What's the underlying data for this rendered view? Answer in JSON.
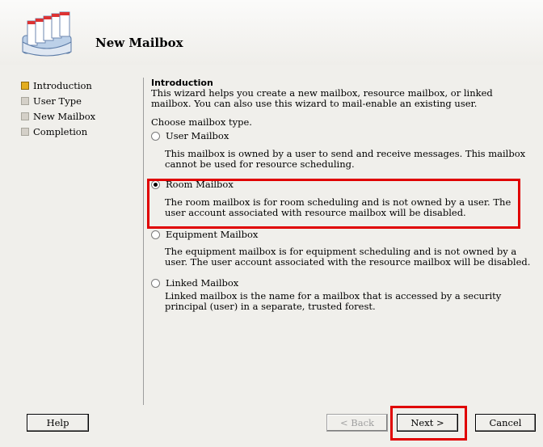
{
  "window": {
    "title": "New Mailbox"
  },
  "nav": {
    "items": [
      {
        "label": "Introduction",
        "active": true
      },
      {
        "label": "User Type",
        "active": false
      },
      {
        "label": "New Mailbox",
        "active": false
      },
      {
        "label": "Completion",
        "active": false
      }
    ]
  },
  "content": {
    "heading": "Introduction",
    "intro": "This wizard helps you create a new mailbox, resource mailbox, or linked mailbox. You can also use this wizard to mail-enable an existing user.",
    "choose_label": "Choose mailbox type.",
    "options": [
      {
        "label": "User Mailbox",
        "selected": false,
        "description": "This mailbox is owned by a user to send and receive messages. This mailbox cannot be used for resource scheduling."
      },
      {
        "label": "Room Mailbox",
        "selected": true,
        "description": "The room mailbox is for room scheduling and is not owned by a user. The user account associated with resource mailbox will be disabled."
      },
      {
        "label": "Equipment Mailbox",
        "selected": false,
        "description": "The equipment mailbox is for equipment scheduling and is not owned by a user. The user account associated with the resource mailbox will be disabled."
      },
      {
        "label": "Linked Mailbox",
        "selected": false,
        "description": "Linked mailbox is the name for a mailbox that is accessed by a security principal (user) in a separate, trusted forest."
      }
    ]
  },
  "buttons": {
    "help": "Help",
    "back": "< Back",
    "next": "Next >",
    "cancel": "Cancel"
  },
  "colors": {
    "highlight": "#e00000",
    "active_step": "#e3ad1e"
  }
}
